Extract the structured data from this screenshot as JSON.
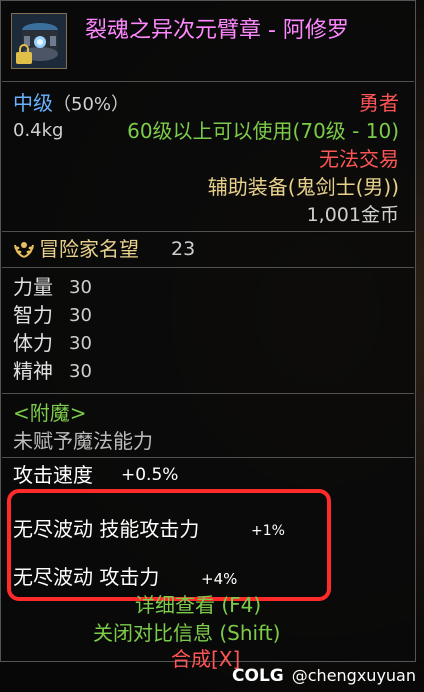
{
  "item": {
    "name": "裂魂之异次元臂章 - 阿修罗",
    "grade": "中级",
    "grade_percent": "（50%）",
    "rarity": "勇者",
    "weight": "0.4kg",
    "level_req": "60级以上可以使用(70级 - 10)",
    "trade": "无法交易",
    "slot": "辅助装备(鬼剑士(男))",
    "price": "1,001金币",
    "lock_icon": "lock-icon"
  },
  "fame": {
    "label": "冒险家名望",
    "value": "23",
    "icon": "laurel-icon"
  },
  "stats": [
    {
      "name": "力量",
      "value": "30"
    },
    {
      "name": "智力",
      "value": "30"
    },
    {
      "name": "体力",
      "value": "30"
    },
    {
      "name": "精神",
      "value": "30"
    }
  ],
  "enchant": {
    "title": "<附魔>",
    "desc": "未赋予魔法能力"
  },
  "attack_speed": {
    "name": "攻击速度",
    "value": "+0.5%"
  },
  "options": [
    {
      "name": "无尽波动 技能攻击力",
      "value": "+1%"
    },
    {
      "name": "无尽波动 攻击力",
      "value": "+4%"
    }
  ],
  "actions": {
    "detail": "详细查看 (F4)",
    "compare": "关闭对比信息 (Shift)",
    "synth": "合成[X]"
  },
  "watermark": {
    "logo": "COLG",
    "user": "@chengxuyuan"
  },
  "colors": {
    "highlight_box": "#ff2a2a",
    "name": "#ff88ff",
    "green": "#7ccc4a",
    "red": "#ff5555",
    "gold": "#e8d18c",
    "blue": "#68b2ff"
  }
}
